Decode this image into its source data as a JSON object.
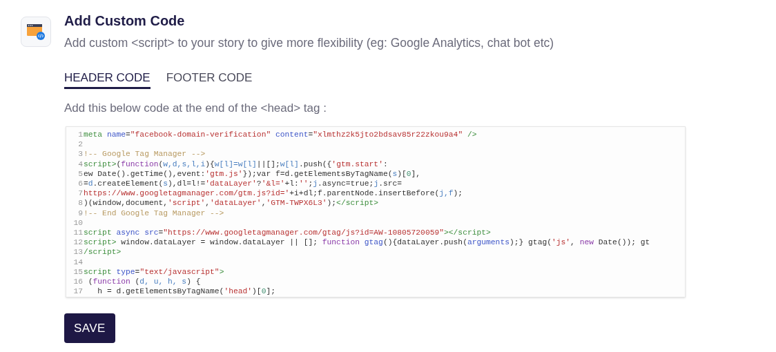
{
  "header": {
    "title": "Add Custom Code",
    "description": "Add custom <script> to your story to give more flexibility (eg: Google Analytics, chat bot etc)"
  },
  "tabs": [
    {
      "label": "HEADER CODE",
      "selected": true
    },
    {
      "label": "FOOTER CODE",
      "selected": false
    }
  ],
  "instruction": "Add this below code at the end of the <head> tag :",
  "code_lines": [
    {
      "n": "1",
      "parts": [
        {
          "kind": "tag",
          "text": "meta"
        },
        {
          "kind": "attr",
          "text": " name"
        },
        {
          "kind": "plain",
          "text": "="
        },
        {
          "kind": "string",
          "text": "\"facebook-domain-verification\""
        },
        {
          "kind": "attr",
          "text": " content"
        },
        {
          "kind": "plain",
          "text": "="
        },
        {
          "kind": "string",
          "text": "\"xlmthz2k5jto2bdsav85r22zkou9a4\""
        },
        {
          "kind": "tag",
          "text": " />"
        }
      ]
    },
    {
      "n": "2"
    },
    {
      "n": "3",
      "parts": [
        {
          "kind": "comment",
          "text": "!-- Google Tag Manager -->"
        }
      ]
    },
    {
      "n": "4",
      "parts": [
        {
          "kind": "tag",
          "text": "script>"
        },
        {
          "kind": "plain",
          "text": "("
        },
        {
          "kind": "keyword",
          "text": "function"
        },
        {
          "kind": "plain",
          "text": "("
        },
        {
          "kind": "var",
          "text": "w,d,s,l,i"
        },
        {
          "kind": "plain",
          "text": "){"
        },
        {
          "kind": "var",
          "text": "w[l]=w[l]"
        },
        {
          "kind": "plain",
          "text": "||[];"
        },
        {
          "kind": "var",
          "text": "w[l]"
        },
        {
          "kind": "plain",
          "text": ".push({"
        },
        {
          "kind": "string",
          "text": "'gtm.start'"
        },
        {
          "kind": "plain",
          "text": ":"
        }
      ]
    },
    {
      "n": "5",
      "parts": [
        {
          "kind": "plain",
          "text": "ew Date().getTime(),event:"
        },
        {
          "kind": "string",
          "text": "'gtm.js'"
        },
        {
          "kind": "plain",
          "text": "});var f=d.getElementsByTagName("
        },
        {
          "kind": "var",
          "text": "s"
        },
        {
          "kind": "plain",
          "text": ")["
        },
        {
          "kind": "number",
          "text": "0"
        },
        {
          "kind": "plain",
          "text": "],"
        }
      ]
    },
    {
      "n": "6",
      "parts": [
        {
          "kind": "plain",
          "text": "="
        },
        {
          "kind": "var",
          "text": "d"
        },
        {
          "kind": "plain",
          "text": ".createElement("
        },
        {
          "kind": "var",
          "text": "s"
        },
        {
          "kind": "plain",
          "text": "),dl=l!="
        },
        {
          "kind": "string",
          "text": "'dataLayer'"
        },
        {
          "kind": "plain",
          "text": "?"
        },
        {
          "kind": "string",
          "text": "'&l='"
        },
        {
          "kind": "plain",
          "text": "+l:"
        },
        {
          "kind": "string",
          "text": "''"
        },
        {
          "kind": "plain",
          "text": ";"
        },
        {
          "kind": "var",
          "text": "j"
        },
        {
          "kind": "plain",
          "text": ".async=true;"
        },
        {
          "kind": "var",
          "text": "j"
        },
        {
          "kind": "plain",
          "text": ".src="
        }
      ]
    },
    {
      "n": "7",
      "parts": [
        {
          "kind": "string",
          "text": "https://www.googletagmanager.com/gtm.js?id='"
        },
        {
          "kind": "plain",
          "text": "+i+dl;f.parentNode.insertBefore("
        },
        {
          "kind": "var",
          "text": "j,f"
        },
        {
          "kind": "plain",
          "text": ");"
        }
      ]
    },
    {
      "n": "8",
      "parts": [
        {
          "kind": "plain",
          "text": ")(window,document,"
        },
        {
          "kind": "string",
          "text": "'script'"
        },
        {
          "kind": "plain",
          "text": ","
        },
        {
          "kind": "string",
          "text": "'dataLayer'"
        },
        {
          "kind": "plain",
          "text": ","
        },
        {
          "kind": "string",
          "text": "'GTM-TWPX6L3'"
        },
        {
          "kind": "plain",
          "text": ");"
        },
        {
          "kind": "tag",
          "text": "</script>"
        }
      ]
    },
    {
      "n": "9",
      "parts": [
        {
          "kind": "comment",
          "text": "!-- End Google Tag Manager -->"
        }
      ]
    },
    {
      "n": "10"
    },
    {
      "n": "11",
      "parts": [
        {
          "kind": "tag",
          "text": "script"
        },
        {
          "kind": "attr",
          "text": " async src"
        },
        {
          "kind": "plain",
          "text": "="
        },
        {
          "kind": "string",
          "text": "\"https://www.googletagmanager.com/gtag/js?id=AW-10805720059\""
        },
        {
          "kind": "tag",
          "text": "></script>"
        }
      ]
    },
    {
      "n": "12",
      "parts": [
        {
          "kind": "tag",
          "text": "script>"
        },
        {
          "kind": "plain",
          "text": " window.dataLayer = window.dataLayer || []; "
        },
        {
          "kind": "keyword",
          "text": "function"
        },
        {
          "kind": "attr",
          "text": " gtag"
        },
        {
          "kind": "plain",
          "text": "(){dataLayer.push("
        },
        {
          "kind": "attr",
          "text": "arguments"
        },
        {
          "kind": "plain",
          "text": ");} gtag("
        },
        {
          "kind": "string",
          "text": "'js'"
        },
        {
          "kind": "plain",
          "text": ", "
        },
        {
          "kind": "keyword",
          "text": "new"
        },
        {
          "kind": "plain",
          "text": " Date()); gt"
        }
      ]
    },
    {
      "n": "13",
      "parts": [
        {
          "kind": "tag",
          "text": "/script>"
        }
      ]
    },
    {
      "n": "14"
    },
    {
      "n": "15",
      "parts": [
        {
          "kind": "tag",
          "text": "script"
        },
        {
          "kind": "attr",
          "text": " type"
        },
        {
          "kind": "plain",
          "text": "="
        },
        {
          "kind": "string",
          "text": "\"text/javascript\""
        },
        {
          "kind": "tag",
          "text": ">"
        }
      ]
    },
    {
      "n": "16",
      "parts": [
        {
          "kind": "plain",
          "text": " ("
        },
        {
          "kind": "keyword",
          "text": "function"
        },
        {
          "kind": "plain",
          "text": " ("
        },
        {
          "kind": "var",
          "text": "d, u, h, s"
        },
        {
          "kind": "plain",
          "text": ") {"
        }
      ]
    },
    {
      "n": "17",
      "parts": [
        {
          "kind": "plain",
          "text": "   h = d.getElementsByTagName("
        },
        {
          "kind": "string",
          "text": "'head'"
        },
        {
          "kind": "plain",
          "text": ")["
        },
        {
          "kind": "number",
          "text": "0"
        },
        {
          "kind": "plain",
          "text": "];"
        }
      ]
    }
  ],
  "save_button": "SAVE"
}
